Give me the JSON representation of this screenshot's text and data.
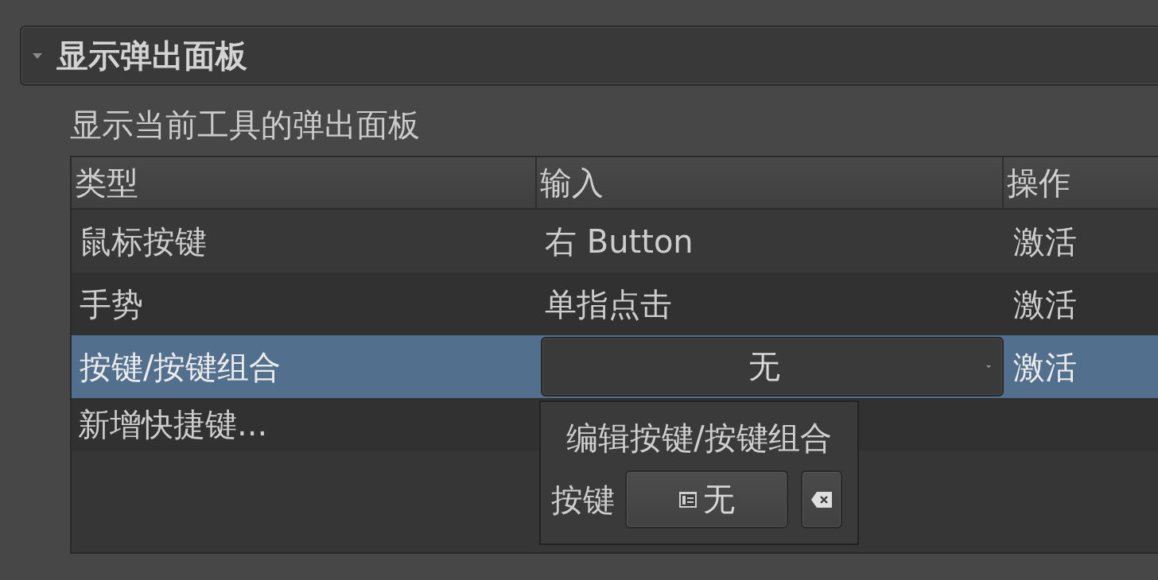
{
  "section": {
    "title": "显示弹出面板",
    "expanded": true,
    "description": "显示当前工具的弹出面板"
  },
  "table": {
    "columns": [
      "类型",
      "输入",
      "操作"
    ],
    "rows": [
      {
        "type": "鼠标按键",
        "kind": "text",
        "input": "右 Button",
        "action": "激活",
        "selected": false
      },
      {
        "type": "手势",
        "kind": "text",
        "input": "单指点击",
        "action": "激活",
        "selected": false
      },
      {
        "type": "按键/按键组合",
        "kind": "dropdown",
        "input": "无",
        "action": "激活",
        "selected": true
      }
    ],
    "add_row": "新增快捷键..."
  },
  "popup": {
    "title": "编辑按键/按键组合",
    "label": "按键",
    "key_value": "无"
  }
}
